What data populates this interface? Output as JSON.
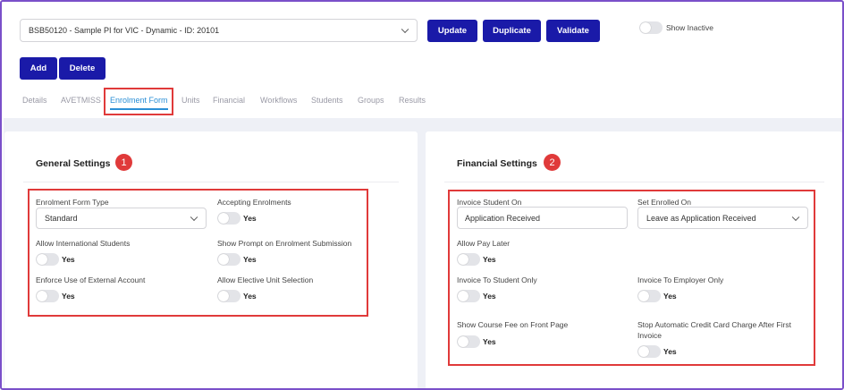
{
  "header": {
    "course_select": "BSB50120 - Sample PI for VIC - Dynamic - ID: 20101",
    "update_label": "Update",
    "duplicate_label": "Duplicate",
    "validate_label": "Validate",
    "show_inactive_label": "Show Inactive",
    "add_label": "Add",
    "delete_label": "Delete"
  },
  "tabs": [
    "Details",
    "AVETMISS",
    "Enrolment Form",
    "Units",
    "Financial",
    "Workflows",
    "Students",
    "Groups",
    "Results"
  ],
  "active_tab": "Enrolment Form",
  "general": {
    "title": "General Settings",
    "badge": "1",
    "enrolment_form_type_label": "Enrolment Form Type",
    "enrolment_form_type_value": "Standard",
    "accepting_enrolments_label": "Accepting Enrolments",
    "allow_international_label": "Allow International Students",
    "show_prompt_label": "Show Prompt on Enrolment Submission",
    "enforce_external_label": "Enforce Use of External Account",
    "allow_elective_label": "Allow Elective Unit Selection",
    "yes": "Yes"
  },
  "financial": {
    "title": "Financial Settings",
    "badge": "2",
    "invoice_student_on_label": "Invoice Student On",
    "invoice_student_on_value": "Application Received",
    "set_enrolled_on_label": "Set Enrolled On",
    "set_enrolled_on_value": "Leave as Application Received",
    "allow_pay_later_label": "Allow Pay Later",
    "invoice_to_student_label": "Invoice To Student Only",
    "invoice_to_employer_label": "Invoice To Employer Only",
    "show_course_fee_label": "Show Course Fee on Front Page",
    "stop_auto_charge_label_1": "Stop Automatic Credit Card Charge After First",
    "stop_auto_charge_label_2": "Invoice",
    "yes": "Yes"
  },
  "colors": {
    "primary": "#1a1aa8",
    "accent": "#2b8fd6",
    "highlight": "#e03a3a",
    "frame": "#7a4fc9"
  }
}
